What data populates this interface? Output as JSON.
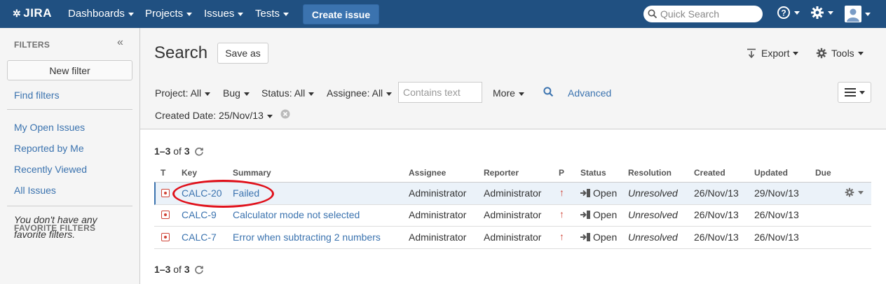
{
  "topbar": {
    "logo": "JIRA",
    "nav": [
      "Dashboards",
      "Projects",
      "Issues",
      "Tests"
    ],
    "create_label": "Create issue",
    "quick_search_placeholder": "Quick Search"
  },
  "sidebar": {
    "filters_heading": "FILTERS",
    "new_filter_label": "New filter",
    "find_filters_label": "Find filters",
    "links": [
      "My Open Issues",
      "Reported by Me",
      "Recently Viewed",
      "All Issues"
    ],
    "favorite_heading": "FAVORITE FILTERS",
    "favorite_empty": "You don't have any favorite filters."
  },
  "header": {
    "title": "Search",
    "save_as_label": "Save as",
    "export_label": "Export",
    "tools_label": "Tools"
  },
  "criteria": {
    "project": "Project: All",
    "type": "Bug",
    "status": "Status: All",
    "assignee": "Assignee: All",
    "text_placeholder": "Contains text",
    "more": "More",
    "advanced": "Advanced",
    "created_date": "Created Date: 25/Nov/13"
  },
  "results": {
    "count_range": "1–3",
    "count_of": "of",
    "count_total": "3",
    "columns": [
      "T",
      "Key",
      "Summary",
      "Assignee",
      "Reporter",
      "P",
      "Status",
      "Resolution",
      "Created",
      "Updated",
      "Due"
    ],
    "rows": [
      {
        "key": "CALC-20",
        "summary": "Failed",
        "assignee": "Administrator",
        "reporter": "Administrator",
        "status": "Open",
        "resolution": "Unresolved",
        "created": "26/Nov/13",
        "updated": "29/Nov/13",
        "due": ""
      },
      {
        "key": "CALC-9",
        "summary": "Calculator mode not selected",
        "assignee": "Administrator",
        "reporter": "Administrator",
        "status": "Open",
        "resolution": "Unresolved",
        "created": "26/Nov/13",
        "updated": "26/Nov/13",
        "due": ""
      },
      {
        "key": "CALC-7",
        "summary": "Error when subtracting 2 numbers",
        "assignee": "Administrator",
        "reporter": "Administrator",
        "status": "Open",
        "resolution": "Unresolved",
        "created": "26/Nov/13",
        "updated": "26/Nov/13",
        "due": ""
      }
    ]
  },
  "colors": {
    "topbar": "#205081",
    "link": "#3b73af",
    "priority": "#d04437",
    "annotation": "#e0101a"
  }
}
